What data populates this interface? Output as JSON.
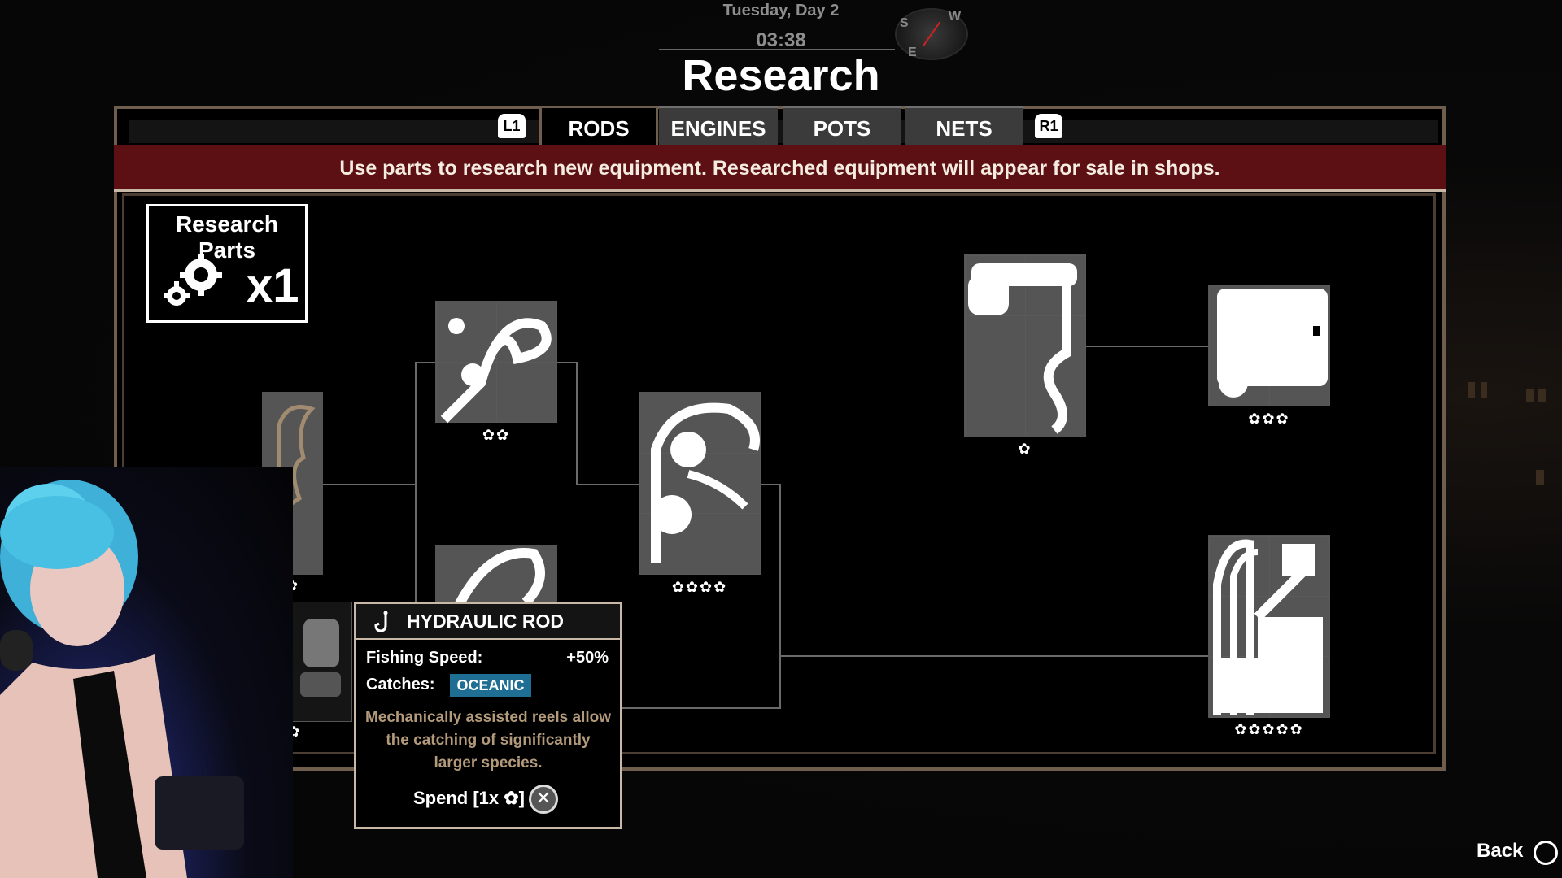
{
  "hud": {
    "day": "Tuesday, Day 2",
    "time": "03:38",
    "compass": [
      "S",
      "W",
      "E"
    ]
  },
  "page_title": "Research",
  "tabs": {
    "left_shoulder": "L1",
    "right_shoulder": "R1",
    "items": [
      {
        "label": "RODS",
        "active": true
      },
      {
        "label": "ENGINES",
        "active": false
      },
      {
        "label": "POTS",
        "active": false
      },
      {
        "label": "NETS",
        "active": false
      }
    ]
  },
  "banner": "Use parts to research new equipment. Researched equipment will appear for sale in shops.",
  "research_parts": {
    "label": "Research Parts",
    "count": "x1"
  },
  "tree": [
    {
      "id": "rod-basic",
      "stars": "✿",
      "state": "owned"
    },
    {
      "id": "rod-reel-small",
      "stars": "✿",
      "state": "owned"
    },
    {
      "id": "rod-tier2",
      "stars": "✿✿",
      "state": "locked"
    },
    {
      "id": "rod-tier2b",
      "stars": "",
      "state": "locked"
    },
    {
      "id": "rod-tier4",
      "stars": "✿✿✿✿",
      "state": "locked"
    },
    {
      "id": "rod-crane",
      "stars": "✿",
      "state": "locked"
    },
    {
      "id": "rod-machine",
      "stars": "✿✿✿",
      "state": "locked"
    },
    {
      "id": "rod-frame",
      "stars": "✿✿✿✿✿",
      "state": "locked"
    }
  ],
  "tooltip": {
    "name": "HYDRAULIC ROD",
    "stat_label": "Fishing Speed:",
    "stat_value": "+50%",
    "catches_label": "Catches:",
    "catches_value": "OCEANIC",
    "description": "Mechanically assisted reels allow the catching of significantly larger species.",
    "spend_label": "Spend [1x ✿]"
  },
  "back_label": "Back",
  "colors": {
    "banner": "#5c1014",
    "frame": "#6f5e4e",
    "badge": "#1e6f93",
    "desc": "#b39a7a"
  }
}
